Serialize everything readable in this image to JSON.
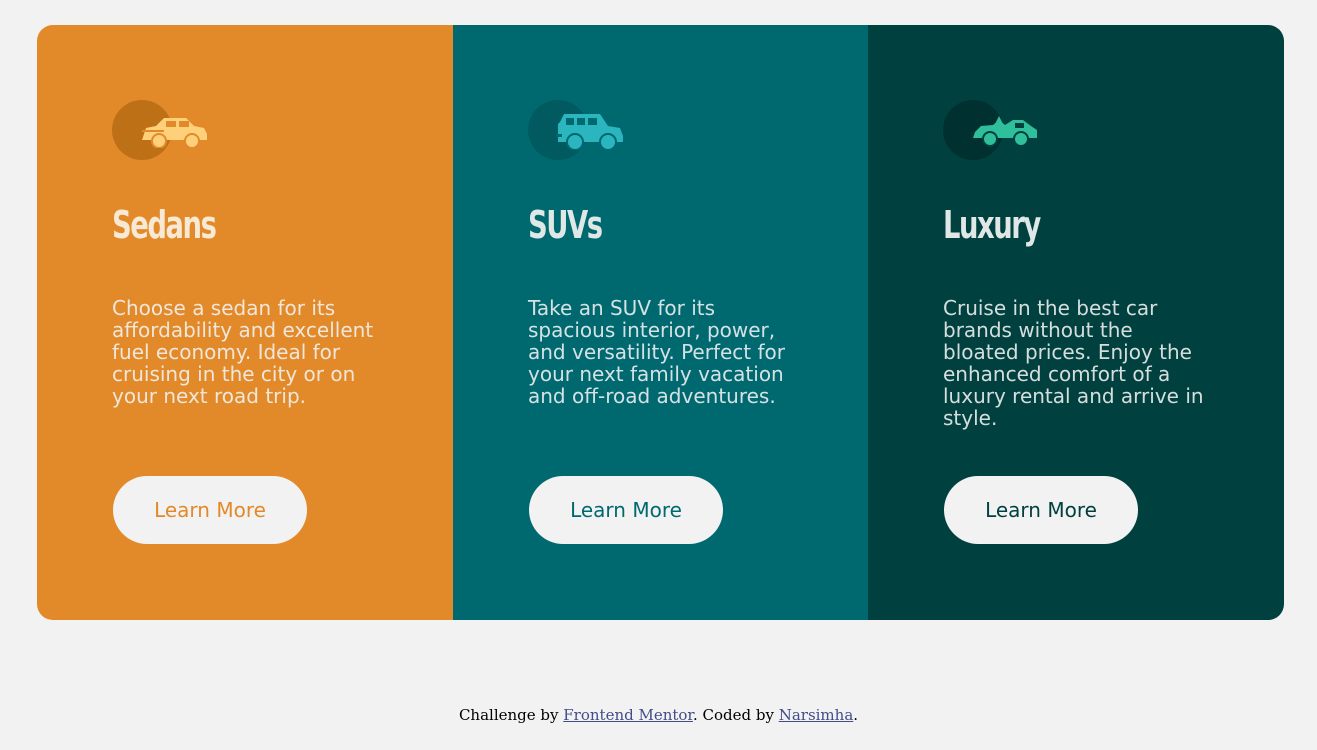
{
  "colors": {
    "page_bg": "#f2f2f2",
    "sedan": "#e28a29",
    "suv": "#006970",
    "luxury": "#004140",
    "light": "#f2f2f2"
  },
  "cards": [
    {
      "icon": "sedan-car-icon",
      "title": "Sedans",
      "description": "Choose a sedan for its affordability and excellent fuel economy. Ideal for cruising in the city or on your next road trip.",
      "button_label": "Learn More"
    },
    {
      "icon": "suv-car-icon",
      "title": "SUVs",
      "description": "Take an SUV for its spacious interior, power, and versatility. Perfect for your next family vacation and off-road adventures.",
      "button_label": "Learn More"
    },
    {
      "icon": "luxury-car-icon",
      "title": "Luxury",
      "description": "Cruise in the best car brands without the bloated prices. Enjoy the enhanced comfort of a luxury rental and arrive in style.",
      "button_label": "Learn More"
    }
  ],
  "footer": {
    "prefix": "Challenge by ",
    "challenge_link": "Frontend Mentor",
    "middle": ". Coded by ",
    "author_link": "Narsimha",
    "suffix": "."
  }
}
